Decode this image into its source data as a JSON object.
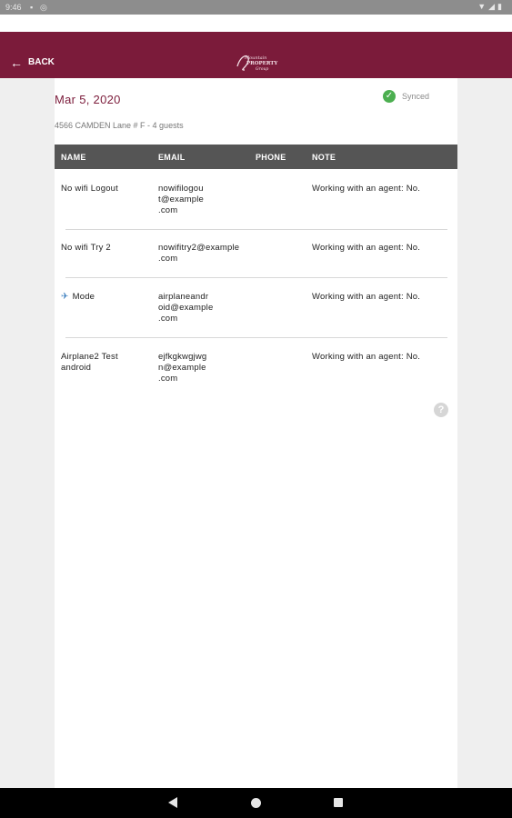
{
  "status_bar": {
    "time": "9:46",
    "right_icons": "▼◢▮"
  },
  "header": {
    "back_label": "BACK",
    "brand_color": "#7b1b3a"
  },
  "visit": {
    "date": "Mar 5, 2020",
    "sync_status": "Synced",
    "address": "4566 CAMDEN Lane # F - 4 guests"
  },
  "table": {
    "columns": [
      "NAME",
      "EMAIL",
      "PHONE",
      "NOTE"
    ],
    "rows": [
      {
        "name": "No wifi  Logout",
        "email": "nowifilogou\nt@example\n.com",
        "phone": "",
        "note": "Working with an agent: No."
      },
      {
        "name": "No wifi Try 2",
        "email": "nowifitry2@example\n.com",
        "phone": "",
        "note": "Working with an agent: No."
      },
      {
        "name": "Mode",
        "email": "airplaneandr\noid@example\n.com",
        "phone": "",
        "note": "Working with an agent: No."
      },
      {
        "name": "Airplane2 Test\nandroid",
        "email": "ejfkgkwgjwg\nn@example\n.com",
        "phone": "",
        "note": "Working with an agent: No."
      }
    ]
  },
  "help_label": "?"
}
